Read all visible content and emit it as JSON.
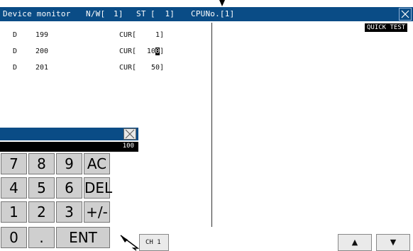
{
  "title_bar": {
    "title": "Device monitor",
    "nw_label": "N/W[",
    "nw_value": "1]",
    "st_label": "ST",
    "st_value": "[  1]",
    "cpu_label": "CPUNo.[1]",
    "close_icon": "close-icon"
  },
  "quick_test_label": "QUICK TEST",
  "device_rows": [
    {
      "device": "D",
      "address": "199",
      "cur_label": "CUR[",
      "value": "1]"
    },
    {
      "device": "D",
      "address": "200",
      "cur_label": "CUR[",
      "value_prefix": "10",
      "value_caret": "0",
      "value_suffix": "]"
    },
    {
      "device": "D",
      "address": "201",
      "cur_label": "CUR[",
      "value": "50]"
    }
  ],
  "keypad": {
    "display_value": "100",
    "close_icon": "close-icon",
    "keys": {
      "k7": "7",
      "k8": "8",
      "k9": "9",
      "ac": "AC",
      "k4": "4",
      "k5": "5",
      "k6": "6",
      "del": "DEL",
      "k1": "1",
      "k2": "2",
      "k3": "3",
      "sign": "+/-",
      "k0": "0",
      "dot": ".",
      "ent": "ENT"
    }
  },
  "bottom_bar": {
    "channel_label": "CH 1",
    "up_icon": "triangle-up-icon",
    "down_icon": "triangle-down-icon",
    "up_glyph": "▲",
    "down_glyph": "▼"
  },
  "colors": {
    "title_bar": "#0a4c86",
    "key_bg": "#cfcfcf",
    "display_bg": "#000000"
  }
}
